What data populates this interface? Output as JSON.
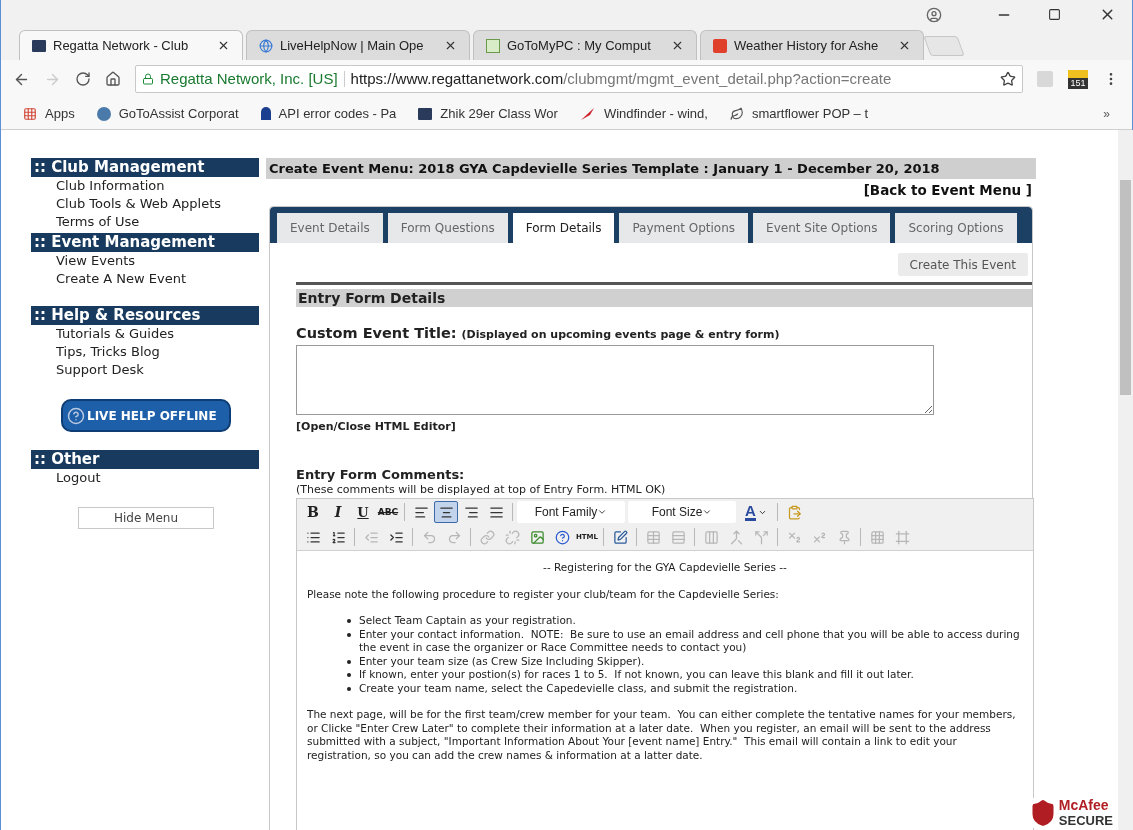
{
  "browser": {
    "tabs": [
      {
        "title": "Regatta Network - Club",
        "kind": "rn",
        "selected": true
      },
      {
        "title": "LiveHelpNow | Main Ope",
        "kind": "globe",
        "selected": false
      },
      {
        "title": "GoToMyPC : My Comput",
        "kind": "mypc",
        "selected": false
      },
      {
        "title": "Weather History for Ashe",
        "kind": "wu",
        "selected": false
      }
    ],
    "secure_label": "Regatta Network, Inc. [US]",
    "url_host": "https://www.regattanetwork.com",
    "url_path": "/clubmgmt/mgmt_event_detail.php?action=create",
    "extension_badge": "151",
    "bookmarks": [
      {
        "label": "Apps",
        "kind": "apps"
      },
      {
        "label": "GoToAssist Corporat",
        "kind": "gotoassist"
      },
      {
        "label": "API error codes - Pa",
        "kind": "paypal"
      },
      {
        "label": "Zhik 29er Class Wor",
        "kind": "rn"
      },
      {
        "label": "Windfinder - wind, ",
        "kind": "windfinder"
      },
      {
        "label": "smartflower POP – t",
        "kind": "leaf"
      }
    ],
    "bookmarks_more": "»"
  },
  "sidebar": [
    {
      "kind": "section",
      "title": ":: Club Management",
      "items": [
        "Club Information",
        "Club Tools & Web Applets",
        "Terms of Use"
      ]
    },
    {
      "kind": "section",
      "title": ":: Event Management",
      "items": [
        "View Events",
        "Create A New Event"
      ]
    },
    {
      "kind": "section",
      "title": ":: Help & Resources",
      "items": [
        "Tutorials & Guides",
        "Tips, Tricks Blog",
        "Support Desk"
      ]
    },
    {
      "kind": "live-help",
      "label": "LIVE HELP OFFLINE"
    },
    {
      "kind": "section",
      "title": ":: Other",
      "items": [
        "Logout"
      ]
    },
    {
      "kind": "plain-button",
      "label": "Hide Menu"
    }
  ],
  "main": {
    "title": "Create Event Menu: 2018 GYA Capdevielle Series Template : January 1 - December 20, 2018",
    "back_link": "[Back to Event Menu ]",
    "tabs": [
      {
        "label": "Event Details",
        "selected": false
      },
      {
        "label": "Form Questions",
        "selected": false
      },
      {
        "label": "Form Details",
        "selected": true
      },
      {
        "label": "Payment Options",
        "selected": false
      },
      {
        "label": "Event Site Options",
        "selected": false
      },
      {
        "label": "Scoring Options",
        "selected": false
      }
    ],
    "create_button": "Create This Event",
    "section_title": "Entry Form Details",
    "custom_title_label": "Custom Event Title:",
    "custom_title_hint": "(Displayed on upcoming events page & entry form)",
    "html_editor_link": "[Open/Close HTML Editor]",
    "comments_label": "Entry Form Comments:",
    "comments_hint": "(These comments will be displayed at top of Entry Form. HTML OK)",
    "editor": {
      "toolbar_rows": [
        [
          {
            "kind": "bold",
            "label": "B",
            "selected": false,
            "disabled": false
          },
          {
            "kind": "italic",
            "label": "I",
            "selected": false,
            "disabled": false
          },
          {
            "kind": "underline",
            "label": "U",
            "selected": false,
            "disabled": false
          },
          {
            "kind": "strike",
            "label": "ABC",
            "selected": false,
            "disabled": false
          },
          {
            "kind": "sep"
          },
          {
            "kind": "align-left",
            "selected": false,
            "disabled": false
          },
          {
            "kind": "align-center",
            "selected": true,
            "disabled": false
          },
          {
            "kind": "align-right",
            "selected": false,
            "disabled": false
          },
          {
            "kind": "justify",
            "selected": false,
            "disabled": false
          },
          {
            "kind": "sep"
          },
          {
            "kind": "select",
            "label": "Font Family",
            "selected": false,
            "disabled": false
          },
          {
            "kind": "select",
            "label": "Font Size",
            "selected": false,
            "disabled": false
          },
          {
            "kind": "color",
            "label": "A",
            "selected": false,
            "disabled": false
          },
          {
            "kind": "sep"
          },
          {
            "kind": "paste",
            "selected": false,
            "disabled": false
          }
        ],
        [
          {
            "kind": "bullets",
            "selected": false,
            "disabled": false
          },
          {
            "kind": "numbers",
            "selected": false,
            "disabled": false
          },
          {
            "kind": "sep"
          },
          {
            "kind": "outdent",
            "selected": false,
            "disabled": true
          },
          {
            "kind": "indent",
            "selected": false,
            "disabled": false
          },
          {
            "kind": "sep"
          },
          {
            "kind": "undo",
            "selected": false,
            "disabled": true
          },
          {
            "kind": "redo",
            "selected": false,
            "disabled": true
          },
          {
            "kind": "sep"
          },
          {
            "kind": "link",
            "selected": false,
            "disabled": true
          },
          {
            "kind": "unlink",
            "selected": false,
            "disabled": true
          },
          {
            "kind": "image",
            "selected": false,
            "disabled": false
          },
          {
            "kind": "help",
            "selected": false,
            "disabled": false
          },
          {
            "kind": "html",
            "label": "HTML",
            "selected": false,
            "disabled": false
          },
          {
            "kind": "sep"
          },
          {
            "kind": "edit",
            "selected": false,
            "disabled": false
          },
          {
            "kind": "sep"
          },
          {
            "kind": "table",
            "selected": false,
            "disabled": true
          },
          {
            "kind": "rows",
            "selected": false,
            "disabled": true
          },
          {
            "kind": "sep"
          },
          {
            "kind": "columns",
            "selected": false,
            "disabled": true
          },
          {
            "kind": "merge",
            "selected": false,
            "disabled": true
          },
          {
            "kind": "split",
            "selected": false,
            "disabled": true
          },
          {
            "kind": "sep"
          },
          {
            "kind": "sub",
            "selected": false,
            "disabled": true
          },
          {
            "kind": "sup",
            "selected": false,
            "disabled": true
          },
          {
            "kind": "pin",
            "selected": false,
            "disabled": true
          },
          {
            "kind": "sep"
          },
          {
            "kind": "grid",
            "selected": false,
            "disabled": true
          },
          {
            "kind": "frame",
            "selected": false,
            "disabled": true
          }
        ]
      ],
      "heading": "-- Registering for the GYA Capdevielle Series --",
      "intro": "Please note the following procedure to register your club/team for the Capdevielle Series:",
      "bullets": [
        "Select Team Captain as your registration.",
        "Enter your contact information.  NOTE:  Be sure to use an email address and cell phone that you will be able to access during the event in case the organizer or Race Committee needs to contact you)",
        "Enter your team size (as Crew Size Including Skipper).",
        "If known, enter your postion(s) for races 1 to 5.  If not known, you can leave this blank and fill it out later.",
        "Create your team name, select the Capedevielle class, and submit the registration."
      ],
      "closing": "The next page, will be for the first team/crew member for your team.  You can either complete the tentative names for your members, or Clicke \"Enter Crew Later\" to complete their information at a later date.  When you register, an email will be sent to the address submitted with a subject, \"Important Information About Your [event name] Entry.\"  This email will contain a link to edit your registration, so you can add the crew names & information at a latter date."
    }
  },
  "badge": {
    "brand": "McAfee",
    "label": "SECURE"
  }
}
